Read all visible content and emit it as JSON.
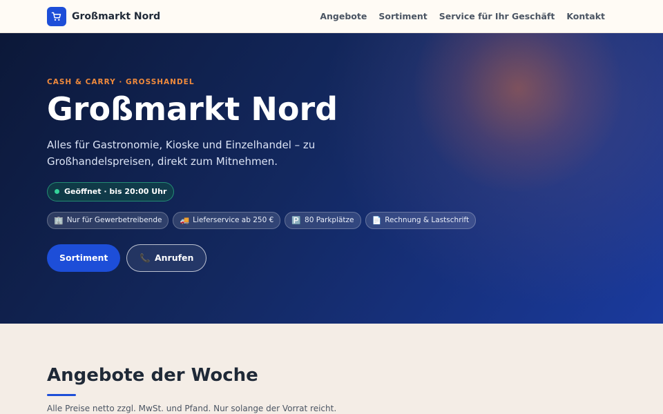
{
  "header": {
    "brand_name": "Großmarkt Nord",
    "logo_icon": "cart-icon",
    "nav": [
      "Angebote",
      "Sortiment",
      "Service für Ihr Geschäft",
      "Kontakt"
    ]
  },
  "hero": {
    "eyebrow": "CASH & CARRY · GROSSHANDEL",
    "title": "Großmarkt Nord",
    "subtitle": "Alles für Gastronomie, Kioske und Einzelhandel – zu Großhandelspreisen, direkt zum Mitnehmen.",
    "status": "Geöffnet · bis 20:00 Uhr",
    "chips": [
      {
        "icon": "🏢",
        "label": "Nur für Gewerbetreibende"
      },
      {
        "icon": "🚚",
        "label": "Lieferservice ab 250 €"
      },
      {
        "icon": "🅿️",
        "label": "80 Parkplätze"
      },
      {
        "icon": "📄",
        "label": "Rechnung & Lastschrift"
      }
    ],
    "primary_cta": "Sortiment",
    "secondary_cta_icon": "📞",
    "secondary_cta": "Anrufen"
  },
  "offers": {
    "title": "Angebote der Woche",
    "note": "Alle Preise netto zzgl. MwSt. und Pfand. Nur solange der Vorrat reicht."
  },
  "colors": {
    "accent": "#1d4ed8",
    "eyebrow": "#f08a3c",
    "status": "#34d399"
  }
}
